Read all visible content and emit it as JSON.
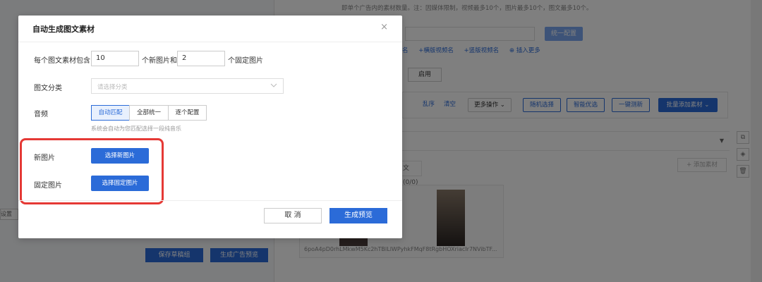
{
  "background": {
    "note": "即单个广告内的素材数量。注：因媒体限制，视频最多10个，图片最多10个，图文最多10个。",
    "unify_button": "统一配置",
    "links": [
      "名",
      "+横版视频名",
      "+竖版视频名",
      "插入更多"
    ],
    "enable_button": "启用",
    "toolbar": {
      "shuffle": "乱序",
      "clear": "清空",
      "more_actions": "更多操作",
      "random_select": "随机选择",
      "smart_optimize": "智能优选",
      "one_click_detect": "一键测新",
      "batch_add": "批量添加素材"
    },
    "tab_label": "文(0/0)",
    "add_material": "+ 添加素材",
    "card_filename": "6poA4pD0rhLMkwM5Kc2hTBILlWPyhkFMqF8tRgbHOXriacIr7NVibTF...",
    "left_field": "设置",
    "save_button": "保存草稿组",
    "generate_ad_button": "生成广告预览"
  },
  "modal": {
    "title": "自动生成图文素材",
    "close": "×",
    "row1": {
      "label": "每个图文素材包含",
      "new_count": "10",
      "new_suffix": "个新图片和",
      "fixed_count": "2",
      "fixed_suffix": "个固定图片"
    },
    "category": {
      "label": "图文分类",
      "placeholder": "请选择分类"
    },
    "audio": {
      "label": "音频",
      "options": [
        "自动匹配",
        "全部统一",
        "逐个配置"
      ],
      "selected": "自动匹配",
      "hint": "系统会自动为您匹配选择一段纯音乐"
    },
    "new_images": {
      "label": "新图片",
      "button": "选择新图片"
    },
    "fixed_images": {
      "label": "固定图片",
      "button": "选择固定图片"
    },
    "footer": {
      "cancel": "取 消",
      "generate": "生成预览"
    }
  }
}
